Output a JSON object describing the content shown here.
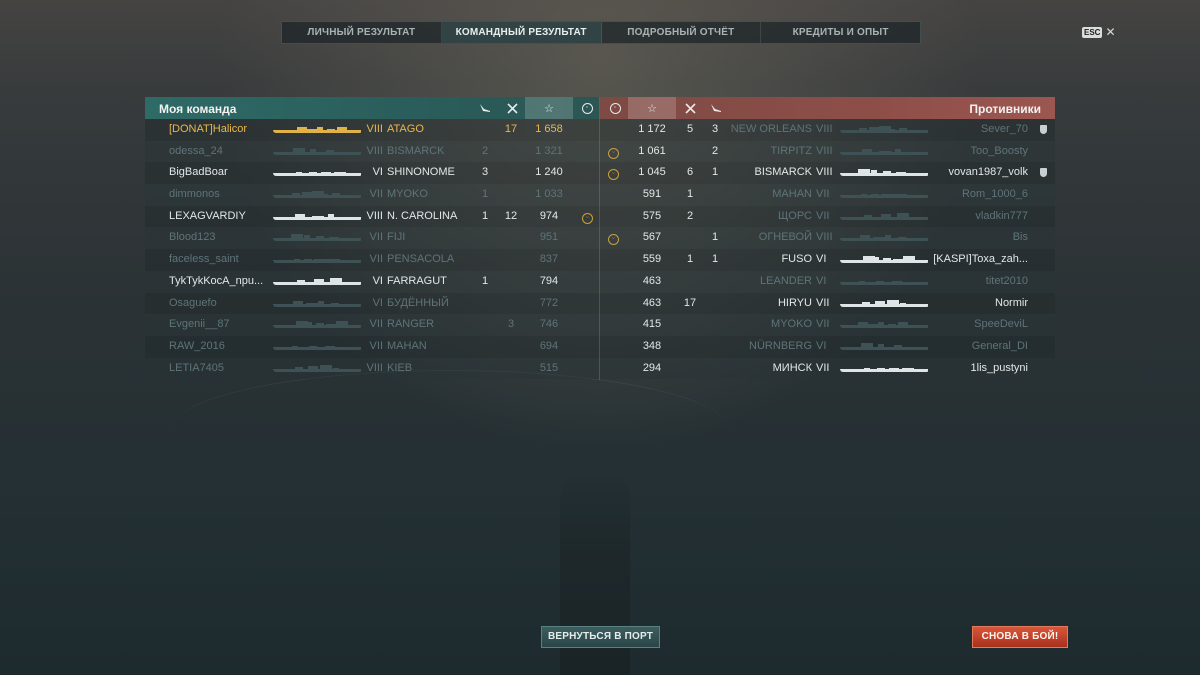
{
  "tabs": [
    {
      "label": "ЛИЧНЫЙ РЕЗУЛЬТАТ",
      "active": false
    },
    {
      "label": "КОМАНДНЫЙ РЕЗУЛЬТАТ",
      "active": true
    },
    {
      "label": "ПОДРОБНЫЙ ОТЧЁТ",
      "active": false
    },
    {
      "label": "КРЕДИТЫ И ОПЫТ",
      "active": false
    }
  ],
  "esc": {
    "key": "ESC",
    "close": "✕"
  },
  "my_team": {
    "title": "Моя команда",
    "icons": {
      "planes": "plane-icon",
      "kills": "crossed-swords-icon",
      "xp": "star-icon",
      "achievements": "smile-icon"
    },
    "players": [
      {
        "name": "[DONAT]Halicor",
        "tier": "VIII",
        "ship": "ATAGO",
        "planes": "",
        "kills": "17",
        "xp": "1 658",
        "ach": false,
        "style": "gold"
      },
      {
        "name": "odessa_24",
        "tier": "VIII",
        "ship": "BISMARCK",
        "planes": "2",
        "kills": "",
        "xp": "1 321",
        "ach": false,
        "style": "dim"
      },
      {
        "name": "BigBadBoar",
        "tier": "VI",
        "ship": "SHINONOME",
        "planes": "3",
        "kills": "",
        "xp": "1 240",
        "ach": false,
        "style": "bright"
      },
      {
        "name": "dimmonos",
        "tier": "VII",
        "ship": "MYOKO",
        "planes": "1",
        "kills": "",
        "xp": "1 033",
        "ach": false,
        "style": "dim"
      },
      {
        "name": "LEXAGVARDIY",
        "tier": "VIII",
        "ship": "N. CAROLINA",
        "planes": "1",
        "kills": "12",
        "xp": "974",
        "ach": true,
        "style": "bright"
      },
      {
        "name": "Blood123",
        "tier": "VII",
        "ship": "FIJI",
        "planes": "",
        "kills": "",
        "xp": "951",
        "ach": false,
        "style": "dim"
      },
      {
        "name": "faceless_saint",
        "tier": "VII",
        "ship": "PENSACOLA",
        "planes": "",
        "kills": "",
        "xp": "837",
        "ach": false,
        "style": "dim"
      },
      {
        "name": "TykTykKocA_npu...",
        "tier": "VI",
        "ship": "FARRAGUT",
        "planes": "1",
        "kills": "",
        "xp": "794",
        "ach": false,
        "style": "bright"
      },
      {
        "name": "Osaguefo",
        "tier": "VI",
        "ship": "БУДЁННЫЙ",
        "planes": "",
        "kills": "",
        "xp": "772",
        "ach": false,
        "style": "dim"
      },
      {
        "name": "Evgenii__87",
        "tier": "VII",
        "ship": "RANGER",
        "planes": "",
        "kills": "3",
        "xp": "746",
        "ach": false,
        "style": "dim"
      },
      {
        "name": "RAW_2016",
        "tier": "VII",
        "ship": "MAHAN",
        "planes": "",
        "kills": "",
        "xp": "694",
        "ach": false,
        "style": "dim"
      },
      {
        "name": "LETIA7405",
        "tier": "VIII",
        "ship": "KIEB",
        "planes": "",
        "kills": "",
        "xp": "515",
        "ach": false,
        "style": "dim"
      }
    ]
  },
  "enemy_team": {
    "title": "Противники",
    "icons": {
      "achievements": "smile-icon",
      "xp": "star-icon",
      "kills": "crossed-swords-icon",
      "planes": "plane-icon"
    },
    "players": [
      {
        "ach": false,
        "xp": "1 172",
        "kills": "5",
        "planes": "3",
        "ship": "NEW ORLEANS",
        "tier": "VIII",
        "name": "Sever_70",
        "badge": true,
        "style": "dim"
      },
      {
        "ach": true,
        "xp": "1 061",
        "kills": "",
        "planes": "2",
        "ship": "TIRPITZ",
        "tier": "VIII",
        "name": "Too_Boosty",
        "badge": false,
        "style": "dim"
      },
      {
        "ach": true,
        "xp": "1 045",
        "kills": "6",
        "planes": "1",
        "ship": "BISMARCK",
        "tier": "VIII",
        "name": "vovan1987_volk",
        "badge": true,
        "style": "bright"
      },
      {
        "ach": false,
        "xp": "591",
        "kills": "1",
        "planes": "",
        "ship": "MAHAN",
        "tier": "VII",
        "name": "Rom_1000_6",
        "badge": false,
        "style": "dim"
      },
      {
        "ach": false,
        "xp": "575",
        "kills": "2",
        "planes": "",
        "ship": "ЩОРС",
        "tier": "VII",
        "name": "vladkin777",
        "badge": false,
        "style": "dim"
      },
      {
        "ach": true,
        "xp": "567",
        "kills": "",
        "planes": "1",
        "ship": "ОГНЕВОЙ",
        "tier": "VIII",
        "name": "Bis",
        "badge": false,
        "style": "dim"
      },
      {
        "ach": false,
        "xp": "559",
        "kills": "1",
        "planes": "1",
        "ship": "FUSO",
        "tier": "VI",
        "name": "[KASPI]Toxa_zah...",
        "badge": false,
        "style": "bright"
      },
      {
        "ach": false,
        "xp": "463",
        "kills": "",
        "planes": "",
        "ship": "LEANDER",
        "tier": "VI",
        "name": "titet2010",
        "badge": false,
        "style": "dim"
      },
      {
        "ach": false,
        "xp": "463",
        "kills": "17",
        "planes": "",
        "ship": "HIRYU",
        "tier": "VII",
        "name": "Normir",
        "badge": false,
        "style": "bright"
      },
      {
        "ach": false,
        "xp": "415",
        "kills": "",
        "planes": "",
        "ship": "MYOKO",
        "tier": "VII",
        "name": "SpeeDeviL",
        "badge": false,
        "style": "dim"
      },
      {
        "ach": false,
        "xp": "348",
        "kills": "",
        "planes": "",
        "ship": "NÜRNBERG",
        "tier": "VI",
        "name": "General_DI",
        "badge": false,
        "style": "dim"
      },
      {
        "ach": false,
        "xp": "294",
        "kills": "",
        "planes": "",
        "ship": "МИНСК",
        "tier": "VII",
        "name": "1lis_pustyni",
        "badge": false,
        "style": "bright"
      }
    ]
  },
  "buttons": {
    "back_to_port": "ВЕРНУТЬСЯ В ПОРТ",
    "to_battle": "СНОВА В БОЙ!"
  },
  "colors": {
    "ally_header": "#2e6a66",
    "enemy_header": "#8e4e48",
    "player_highlight": "#e8b84a",
    "battle_button": "#c8442a"
  }
}
